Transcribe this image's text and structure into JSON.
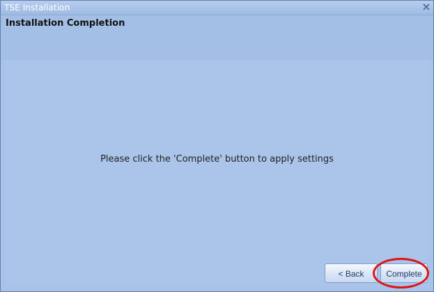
{
  "window": {
    "title": "TSE Installation",
    "close_icon": "×"
  },
  "header": {
    "title": "Installation Completion"
  },
  "main": {
    "instruction": "Please click the 'Complete' button to apply settings"
  },
  "buttons": {
    "back_label": "< Back",
    "complete_label": "Complete"
  },
  "colors": {
    "window_bg": "#a8c2e8",
    "highlight": "#df1414"
  }
}
